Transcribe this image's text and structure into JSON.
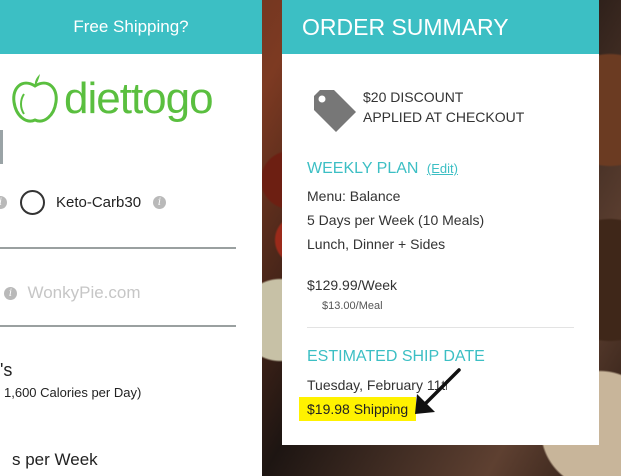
{
  "left_panel": {
    "header_text": "Free Shipping?",
    "logo": {
      "text": "diettogo",
      "icon": "apple-logo-icon",
      "color": "#5abf3f"
    },
    "plan_option": {
      "label": "Keto-Carb30",
      "info_icon": "info-icon",
      "info_glyph": "i"
    },
    "watermark": "WonkyPie.com",
    "s_text": "'s",
    "calories_text": "1,600 Calories per Day)",
    "per_week_text": "s per Week"
  },
  "order_summary": {
    "title": "ORDER SUMMARY",
    "discount_icon": "price-tag-icon",
    "discount_line1": "$20 DISCOUNT",
    "discount_line2": "APPLIED AT CHECKOUT",
    "weekly_plan": {
      "title": "WEEKLY PLAN",
      "edit_label": "(Edit)",
      "menu": "Menu: Balance",
      "days": "5 Days per Week (10 Meals)",
      "meals": "Lunch, Dinner + Sides",
      "price": "$129.99/Week",
      "per_meal": "$13.00/Meal"
    },
    "ship": {
      "title": "ESTIMATED SHIP DATE",
      "date": "Tuesday, February 11th",
      "shipping": "$19.98 Shipping"
    }
  },
  "annotation": {
    "arrow_icon": "arrow-down-left-icon",
    "highlight_color": "#fff200"
  },
  "colors": {
    "accent": "#3cbfc4"
  }
}
